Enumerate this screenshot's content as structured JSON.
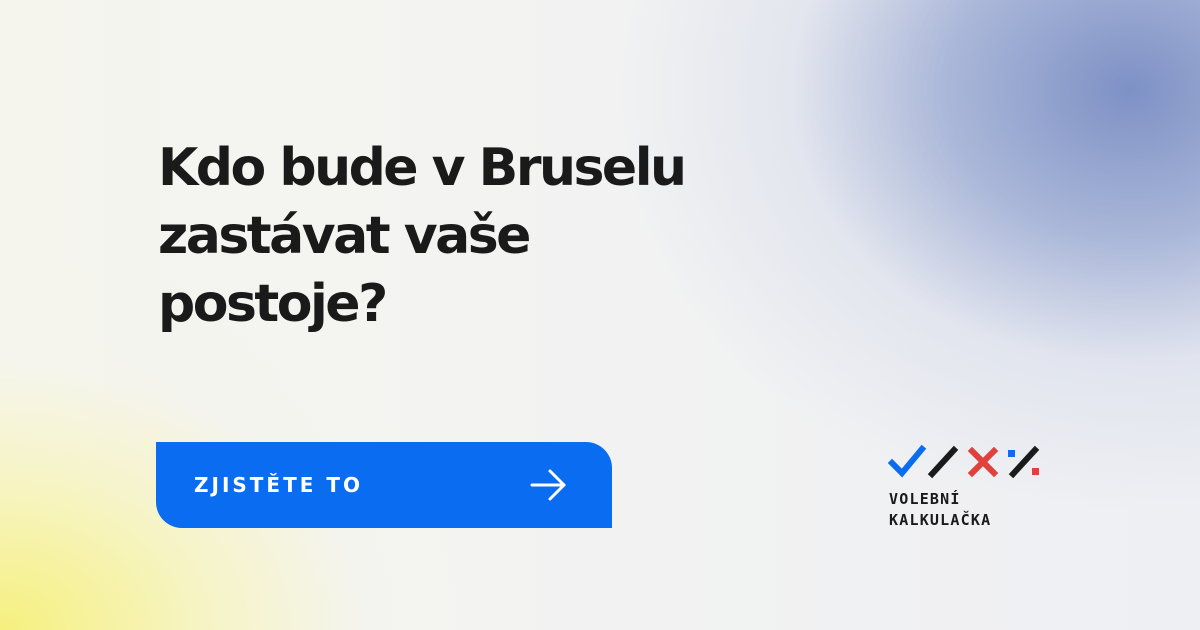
{
  "headline": {
    "line1": "Kdo bude v Bruselu",
    "line2": "zastávat vaše",
    "line3": "postoje?"
  },
  "cta": {
    "label": "ZJISTĚTE TO",
    "icon": "arrow-right-icon",
    "color": "#0a6cf0"
  },
  "logo": {
    "line1": "VOLEBNÍ",
    "line2": "KALKULAČKA",
    "marks": [
      "check-icon",
      "slash-icon",
      "cross-icon",
      "percent-icon"
    ],
    "colors": {
      "blue": "#0a6cf0",
      "dark": "#1a1a1a",
      "red": "#e0413c"
    }
  }
}
